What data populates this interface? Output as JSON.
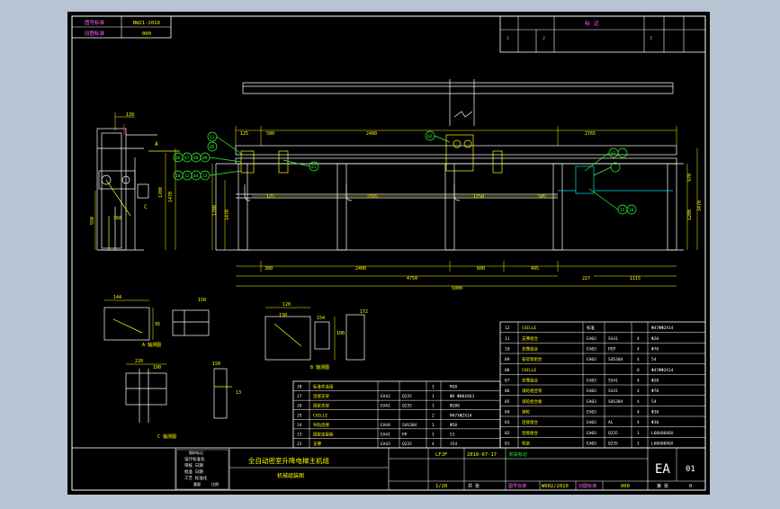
{
  "colors": {
    "frame_outer": "#b7c4d3",
    "paper": "#000000",
    "line": "#ffffff",
    "yellow": "#ffff00",
    "magenta": "#ff66ff",
    "green": "#33ff33",
    "cyan": "#00e0e0",
    "red": "#ff3333"
  },
  "top_stamp": {
    "row1_label": "图号标准",
    "row1_value": "BW21-2010",
    "row2_label": "旧图标准",
    "row2_value": "000"
  },
  "revision_block": {
    "heading": "标 记",
    "numbers": [
      "1",
      "2",
      "3"
    ]
  },
  "main_view": {
    "dims_top": [
      "2400",
      "2765",
      "500",
      "125"
    ],
    "dims_bottom": [
      "300",
      "2400",
      "600",
      "495",
      "4750",
      "227",
      "1115",
      "5000"
    ],
    "dims_inner": [
      "2165",
      "505",
      "125",
      "1250"
    ],
    "dims_right": [
      "970",
      "1200",
      "3470"
    ],
    "dims_left": [
      "1200",
      "1470"
    ],
    "balloons": [
      "01",
      "02",
      "03",
      "04",
      "05",
      "06",
      "07",
      "08",
      "09",
      "10",
      "11",
      "12",
      "13"
    ],
    "balloon_labels": [
      "11",
      "05",
      "06",
      "07",
      "08",
      "09",
      "10",
      "12",
      "04",
      "13",
      "01",
      "02",
      "03",
      "15",
      "16"
    ]
  },
  "side_view": {
    "dims": [
      "139",
      "A",
      "360",
      "550",
      "1200",
      "1470",
      "1580"
    ],
    "label_a": "A",
    "label_c": "C"
  },
  "details": {
    "a_view_title": "A 轴测图",
    "b_view_title": "B 轴测图",
    "c_view_title": "C 轴测图",
    "a_dims": [
      "144",
      "95",
      "150"
    ],
    "b_dims": [
      "120",
      "100",
      "154",
      "172",
      "130"
    ],
    "c_dims": [
      "220",
      "190",
      "150",
      "13"
    ]
  },
  "parts_table_left": {
    "rows": [
      {
        "no": "J8",
        "name": "标准件连接",
        "code": "",
        "mat": "",
        "qty": "1",
        "spec": "M20",
        "wt": ""
      },
      {
        "no": "J7",
        "name": "连接支架",
        "code": "EA42",
        "mat": "Q235",
        "qty": "1",
        "spec": "Φ6 ΦB04X63",
        "wt": ""
      },
      {
        "no": "J6",
        "name": "固定支架",
        "code": "EA41",
        "mat": "Q235",
        "qty": "1",
        "spec": "Φ200",
        "wt": ""
      },
      {
        "no": "J5",
        "name": "CUILLE",
        "code": "",
        "mat": "",
        "qty": "2",
        "spec": "M47XΦ2X14",
        "wt": ""
      },
      {
        "no": "J4",
        "name": "导轨连接",
        "code": "EA44",
        "mat": "SUS304",
        "qty": "1",
        "spec": "Φ50",
        "wt": ""
      },
      {
        "no": "J3",
        "name": "固定连接板",
        "code": "EA41",
        "mat": "PP",
        "qty": "1",
        "spec": "S1",
        "wt": ""
      },
      {
        "no": "J2",
        "name": "支撑",
        "code": "EA43",
        "mat": "Q235",
        "qty": "4",
        "spec": "J54",
        "wt": ""
      }
    ]
  },
  "parts_table_right": {
    "rows": [
      {
        "no": "12",
        "name": "CUILLE",
        "code": "标准",
        "qty": "",
        "spec": "Φ47ΦΦ2X14"
      },
      {
        "no": "11",
        "name": "支撑组合",
        "code": "EA03",
        "mat": "SS41",
        "qty": "4",
        "spec": "Φ20"
      },
      {
        "no": "10",
        "name": "支撑组合",
        "code": "EA03",
        "mat": "PEP",
        "qty": "4",
        "spec": "Φ70"
      },
      {
        "no": "09",
        "name": "安装架组合",
        "code": "EA03",
        "mat": "SUS304",
        "qty": "4",
        "spec": "54"
      },
      {
        "no": "08",
        "name": "CUILLE",
        "code": "",
        "mat": "",
        "qty": "8",
        "spec": "Φ47ΦΦ2X14"
      },
      {
        "no": "07",
        "name": "支撑组合",
        "code": "EA03",
        "mat": "SS41",
        "qty": "4",
        "spec": "Φ20"
      },
      {
        "no": "06",
        "name": "滚轮组合架",
        "code": "EA03",
        "mat": "SS41",
        "qty": "4",
        "spec": "Φ70"
      },
      {
        "no": "05",
        "name": "滚轮组合板",
        "code": "EA03",
        "mat": "SUS304",
        "qty": "4",
        "spec": "54"
      },
      {
        "no": "04",
        "name": "滚轮",
        "code": "EA03",
        "mat": "",
        "qty": "4",
        "spec": "Φ30"
      },
      {
        "no": "03",
        "name": "连接组合",
        "code": "EA03",
        "mat": "AL",
        "qty": "4",
        "spec": "Φ30"
      },
      {
        "no": "02",
        "name": "连接组合",
        "code": "EA03",
        "mat": "Q235",
        "qty": "1",
        "spec": "L60X60X6X"
      },
      {
        "no": "01",
        "name": "机架",
        "code": "EA03",
        "mat": "Q235",
        "qty": "1",
        "spec": "L60X60X6X"
      }
    ]
  },
  "header_row": {
    "no": "序号",
    "name": "名称",
    "code": "图号",
    "mat": "材料",
    "qty": "数量",
    "spec": "规格"
  },
  "title_block": {
    "stamp_lines": [
      "设计标准化",
      "审核 日期",
      "批准 日期",
      "工艺 标准化"
    ],
    "stamp_small": [
      "图样标记",
      "重量",
      "比例"
    ],
    "title": "全自动密室升降电梯主机组",
    "subtitle": "机械组装图",
    "designer": "LFJF",
    "date": "2010-07-17",
    "scale": "1/20",
    "sheet_label": "共 张",
    "stage_label": "阶段标记",
    "drawing_no": "W002/2010",
    "old_no": "000",
    "doc_code": "EA",
    "doc_num": "01",
    "page_label": "第 张",
    "page_num": "0"
  }
}
